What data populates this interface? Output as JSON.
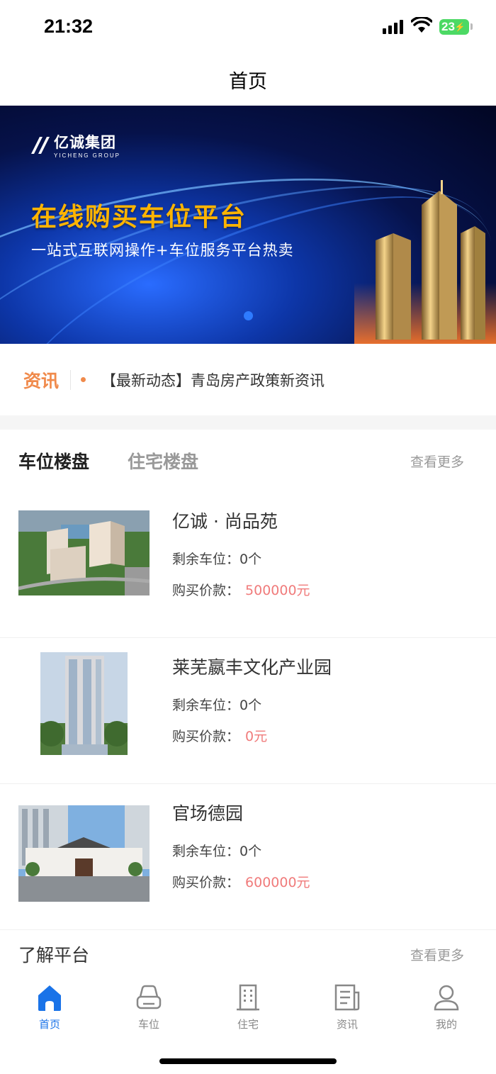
{
  "status": {
    "time": "21:32",
    "battery": "23"
  },
  "header": {
    "title": "首页"
  },
  "banner": {
    "logo_text": "亿诚集团",
    "logo_sub": "YICHENG GROUP",
    "title": "在线购买车位平台",
    "subtitle": "一站式互联网操作+车位服务平台热卖"
  },
  "news": {
    "label": "资讯",
    "headline": "【最新动态】青岛房产政策新资讯"
  },
  "tabs": {
    "items": [
      "车位楼盘",
      "住宅楼盘"
    ],
    "more": "查看更多"
  },
  "listings": [
    {
      "name": "亿诚 · 尚品苑",
      "remaining_label": "剩余车位：",
      "remaining": "0个",
      "price_label": "购买价款：",
      "price": "500000元"
    },
    {
      "name": "莱芜嬴丰文化产业园",
      "remaining_label": "剩余车位：",
      "remaining": "0个",
      "price_label": "购买价款：",
      "price": "0元"
    },
    {
      "name": "官场德园",
      "remaining_label": "剩余车位：",
      "remaining": "0个",
      "price_label": "购买价款：",
      "price": "600000元"
    }
  ],
  "about": {
    "title": "了解平台",
    "more": "查看更多"
  },
  "tabbar": {
    "items": [
      {
        "label": "首页",
        "icon": "home-icon"
      },
      {
        "label": "车位",
        "icon": "car-icon"
      },
      {
        "label": "住宅",
        "icon": "building-icon"
      },
      {
        "label": "资讯",
        "icon": "news-icon"
      },
      {
        "label": "我的",
        "icon": "profile-icon"
      }
    ]
  },
  "colors": {
    "accent": "#1a73e8",
    "news": "#f08a4b",
    "price": "#f07b7b",
    "banner_title": "#ffb400"
  }
}
